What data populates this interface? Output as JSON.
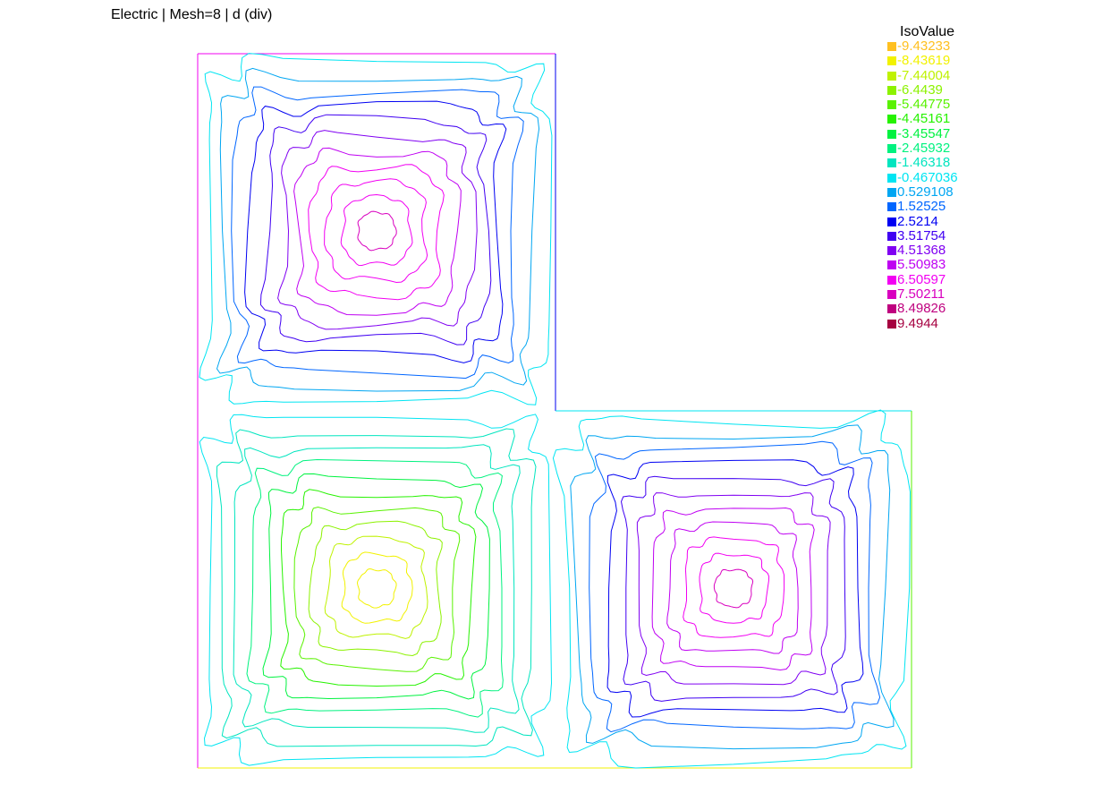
{
  "title": "Electric | Mesh=8 | d (div)",
  "legend": {
    "title": "IsoValue",
    "items": [
      {
        "label": "-9.43233",
        "color": "#ffc020"
      },
      {
        "label": "-8.43619",
        "color": "#f2f200"
      },
      {
        "label": "-7.44004",
        "color": "#bff200"
      },
      {
        "label": "-6.4439",
        "color": "#8cf200"
      },
      {
        "label": "-5.44775",
        "color": "#59f200"
      },
      {
        "label": "-4.45161",
        "color": "#26f200"
      },
      {
        "label": "-3.45547",
        "color": "#00f240"
      },
      {
        "label": "-2.45932",
        "color": "#00f27f"
      },
      {
        "label": "-1.46318",
        "color": "#00e5bf"
      },
      {
        "label": "-0.467036",
        "color": "#00e5f2"
      },
      {
        "label": "0.529108",
        "color": "#00a6f2"
      },
      {
        "label": "1.52525",
        "color": "#0066ff"
      },
      {
        "label": "2.5214",
        "color": "#0000f2"
      },
      {
        "label": "3.51754",
        "color": "#4000f2"
      },
      {
        "label": "4.51368",
        "color": "#8000f2"
      },
      {
        "label": "5.50983",
        "color": "#bf00f2"
      },
      {
        "label": "6.50597",
        "color": "#f200f2"
      },
      {
        "label": "7.50211",
        "color": "#d900bf"
      },
      {
        "label": "8.49826",
        "color": "#bf007f"
      },
      {
        "label": "9.4944",
        "color": "#a60040"
      }
    ]
  },
  "regions": [
    {
      "name": "top-left",
      "levels": [
        9,
        10,
        11,
        12,
        13,
        14,
        15,
        16,
        16,
        16,
        17
      ],
      "wiggle": 1
    },
    {
      "name": "bottom-left",
      "levels": [
        9,
        8,
        8,
        7,
        6,
        5,
        4,
        3,
        2,
        1,
        1
      ],
      "wiggle": 2
    },
    {
      "name": "bottom-right",
      "levels": [
        9,
        10,
        11,
        12,
        13,
        14,
        15,
        15,
        16,
        16,
        17
      ],
      "wiggle": 3
    }
  ],
  "boundary_colors": {
    "left": "#f200f2",
    "top": "#f200f2",
    "inner_right": "#0000f2",
    "inner_top": "#00e5f2",
    "right": "#59f200",
    "bottom": "#f2f200"
  }
}
